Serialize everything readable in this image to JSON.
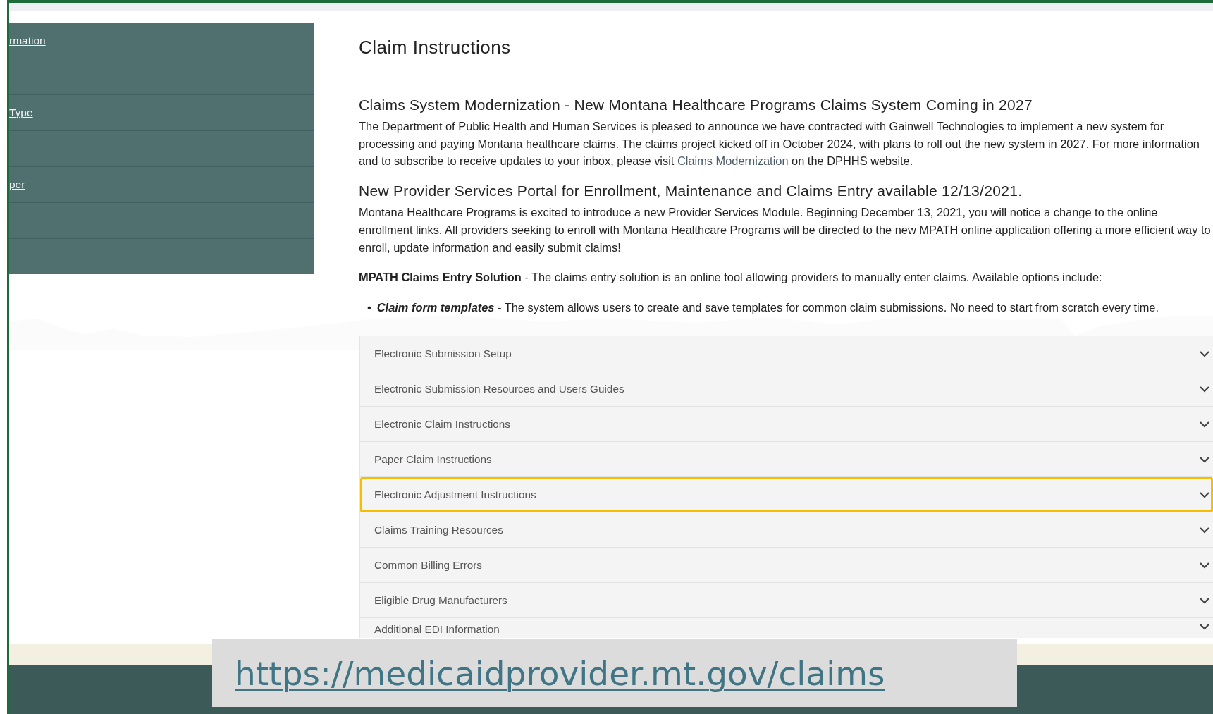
{
  "sidebar": {
    "items": [
      {
        "label": "rmation"
      },
      {
        "label": "Type"
      },
      {
        "label": "per"
      }
    ]
  },
  "content": {
    "title": "Claim Instructions",
    "sections": [
      {
        "heading": "Claims System Modernization - New Montana Healthcare Programs Claims System Coming in 2027",
        "paragraphs": [
          {
            "before": "The Department of Public Health and Human Services is pleased to announce we have contracted with Gainwell Technologies to implement a new system for processing and paying Montana healthcare claims. The claims project kicked off in October 2024, with plans to roll out the new system in 2027. For more information and to subscribe to receive updates to your inbox, please visit",
            "link": "Claims Modernization",
            "after": "on the DPHHS website."
          }
        ]
      },
      {
        "heading": "New Provider Services Portal for Enrollment, Maintenance and Claims Entry available 12/13/2021.",
        "paragraphs": [
          {
            "before": "Montana Healthcare Programs is excited to introduce a new Provider Services Module. Beginning December 13, 2021, you will notice a change to the online enrollment links. All providers seeking to enroll with Montana Healthcare Programs will be directed to the new MPATH online application offering a more efficient way to enroll, update information and easily submit claims!"
          }
        ]
      }
    ],
    "lead": "**MPATH Claims Entry Solution** - The claims entry solution is an online tool allowing providers to manually enter claims. Available options include:",
    "bullets": [
      {
        "marker": "•",
        "term": "Claim form templates",
        "text": "- The system allows users to create and save templates for common claim submissions. No need to start from scratch every time."
      }
    ]
  },
  "accordion": [
    {
      "label": "Electronic Submission Setup",
      "selected": false
    },
    {
      "label": "Electronic Submission Resources and Users Guides",
      "selected": false
    },
    {
      "label": "Electronic Claim Instructions",
      "selected": false
    },
    {
      "label": "Paper Claim Instructions",
      "selected": false
    },
    {
      "label": "Electronic Adjustment Instructions",
      "selected": true
    },
    {
      "label": "Claims Training Resources",
      "selected": false
    },
    {
      "label": "Common Billing Errors",
      "selected": false
    },
    {
      "label": "Eligible Drug Manufacturers",
      "selected": false
    },
    {
      "label": "Additional EDI Information",
      "selected": false
    }
  ],
  "url_caption": "https://medicaidprovider.mt.gov/claims"
}
